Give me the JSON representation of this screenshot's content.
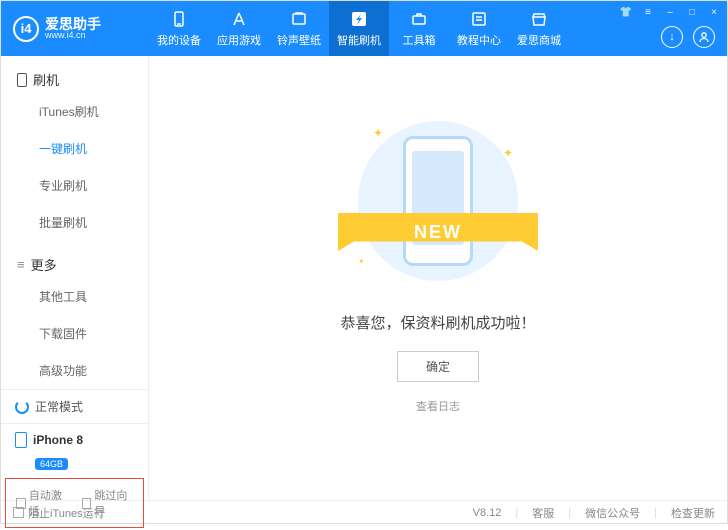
{
  "logo": {
    "brand": "爱思助手",
    "url": "www.i4.cn",
    "badge": "i4"
  },
  "nav": [
    {
      "label": "我的设备",
      "icon": "device"
    },
    {
      "label": "应用游戏",
      "icon": "apps"
    },
    {
      "label": "铃声壁纸",
      "icon": "ring"
    },
    {
      "label": "智能刷机",
      "icon": "flash",
      "active": true
    },
    {
      "label": "工具箱",
      "icon": "tools"
    },
    {
      "label": "教程中心",
      "icon": "tutorial"
    },
    {
      "label": "爱思商城",
      "icon": "store"
    }
  ],
  "sidebar": {
    "sections": [
      {
        "title": "刷机",
        "icon": "phone",
        "items": [
          {
            "label": "iTunes刷机"
          },
          {
            "label": "一键刷机",
            "active": true
          },
          {
            "label": "专业刷机"
          },
          {
            "label": "批量刷机"
          }
        ]
      },
      {
        "title": "更多",
        "icon": "menu",
        "items": [
          {
            "label": "其他工具"
          },
          {
            "label": "下载固件"
          },
          {
            "label": "高级功能"
          }
        ]
      }
    ],
    "mode": "正常模式",
    "device": "iPhone 8",
    "storage": "64GB",
    "checks": [
      {
        "label": "自动激活"
      },
      {
        "label": "跳过向导"
      }
    ]
  },
  "main": {
    "ribbon": "NEW",
    "success": "恭喜您，保资料刷机成功啦！",
    "ok": "确定",
    "log": "查看日志"
  },
  "footer": {
    "block": "阻止iTunes运行",
    "version": "V8.12",
    "links": [
      "客服",
      "微信公众号",
      "检查更新"
    ]
  }
}
